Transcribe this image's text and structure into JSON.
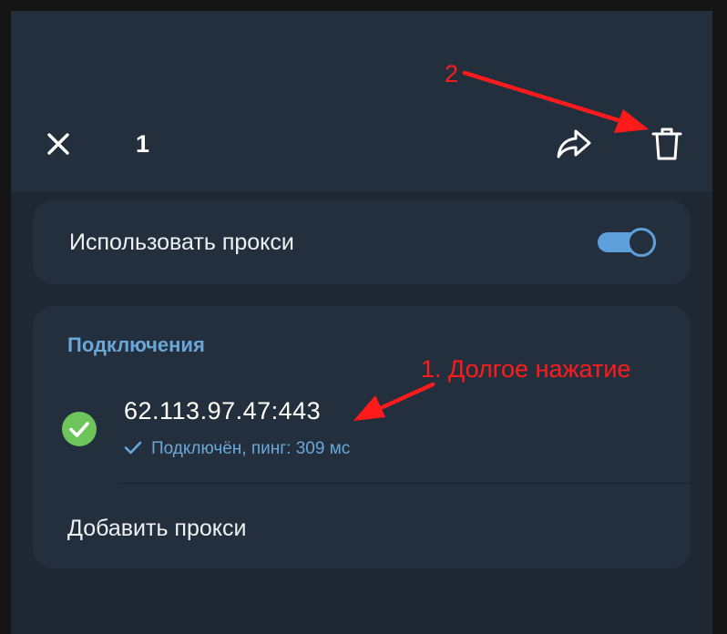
{
  "header": {
    "selected_count": "1",
    "icons": {
      "close": "close-icon",
      "share": "share-arrow-icon",
      "delete": "trash-icon"
    }
  },
  "proxy_toggle": {
    "label": "Использовать прокси",
    "enabled": true
  },
  "connections": {
    "heading": "Подключения",
    "items": [
      {
        "address": "62.113.97.47:443",
        "status": "Подключён, пинг: 309 мс",
        "status_icon": "check-circle-icon"
      }
    ],
    "add_label": "Добавить прокси"
  },
  "annotations": {
    "step1": "1. Долгое нажатие",
    "step2": "2"
  },
  "colors": {
    "background": "#1e2732",
    "header": "#242f3d",
    "card": "#242f3d",
    "accent": "#6aa7d9",
    "toggle": "#5d9fdb",
    "status_ok": "#6ec55a",
    "annotation": "#ff1b1b"
  }
}
